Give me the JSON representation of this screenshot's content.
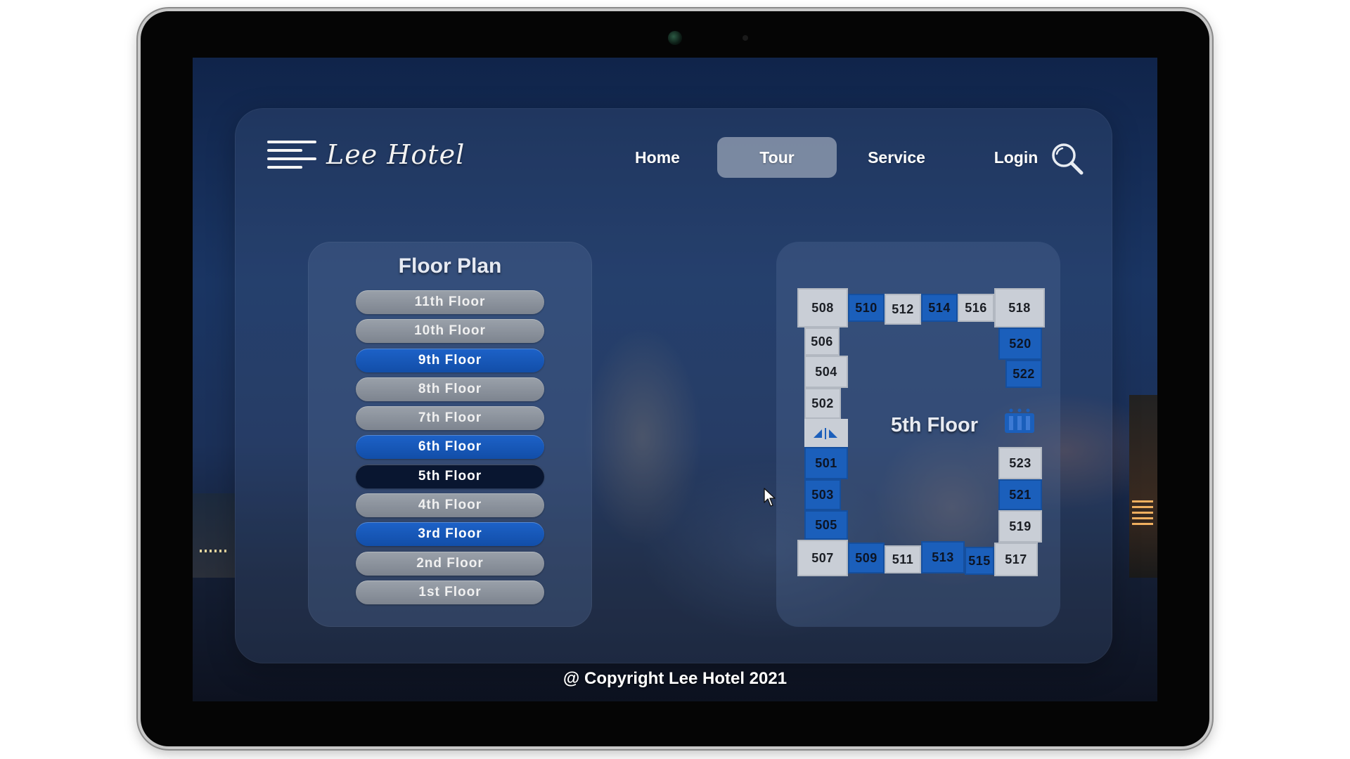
{
  "header": {
    "logo_text": "Lee Hotel",
    "nav": [
      {
        "label": "Home",
        "active": false
      },
      {
        "label": "Tour",
        "active": true
      },
      {
        "label": "Service",
        "active": false
      },
      {
        "label": "Login",
        "active": false
      }
    ],
    "search_icon": "search-icon",
    "menu_icon": "hamburger-menu-icon"
  },
  "floor_plan": {
    "title": "Floor Plan",
    "floors": [
      {
        "label": "11th Floor",
        "style": "gray"
      },
      {
        "label": "10th Floor",
        "style": "gray"
      },
      {
        "label": "9th Floor",
        "style": "blue"
      },
      {
        "label": "8th Floor",
        "style": "gray"
      },
      {
        "label": "7th Floor",
        "style": "gray"
      },
      {
        "label": "6th Floor",
        "style": "blue"
      },
      {
        "label": "5th Floor",
        "style": "selected"
      },
      {
        "label": "4th Floor",
        "style": "gray"
      },
      {
        "label": "3rd Floor",
        "style": "blue"
      },
      {
        "label": "2nd Floor",
        "style": "gray"
      },
      {
        "label": "1st Floor",
        "style": "gray"
      }
    ]
  },
  "floor_map": {
    "title": "5th Floor",
    "rooms": [
      {
        "number": "508",
        "style": "gray"
      },
      {
        "number": "510",
        "style": "blue"
      },
      {
        "number": "512",
        "style": "gray"
      },
      {
        "number": "514",
        "style": "blue"
      },
      {
        "number": "516",
        "style": "gray"
      },
      {
        "number": "518",
        "style": "gray"
      },
      {
        "number": "506",
        "style": "gray"
      },
      {
        "number": "520",
        "style": "blue"
      },
      {
        "number": "504",
        "style": "gray"
      },
      {
        "number": "522",
        "style": "blue"
      },
      {
        "number": "502",
        "style": "gray"
      },
      {
        "number": "501",
        "style": "blue"
      },
      {
        "number": "523",
        "style": "gray"
      },
      {
        "number": "503",
        "style": "blue"
      },
      {
        "number": "521",
        "style": "blue"
      },
      {
        "number": "505",
        "style": "blue"
      },
      {
        "number": "519",
        "style": "gray"
      },
      {
        "number": "507",
        "style": "gray"
      },
      {
        "number": "509",
        "style": "blue"
      },
      {
        "number": "511",
        "style": "gray"
      },
      {
        "number": "513",
        "style": "blue"
      },
      {
        "number": "515",
        "style": "blue"
      },
      {
        "number": "517",
        "style": "gray"
      }
    ],
    "icons": [
      "restroom-icon",
      "elevator-icon"
    ]
  },
  "footer": {
    "copyright": "@ Copyright Lee Hotel 2021"
  },
  "colors": {
    "accent_blue": "#1b5fbb",
    "selected_dark": "#091630",
    "button_gray": "#8a919b",
    "room_gray": "#c9ced6"
  }
}
